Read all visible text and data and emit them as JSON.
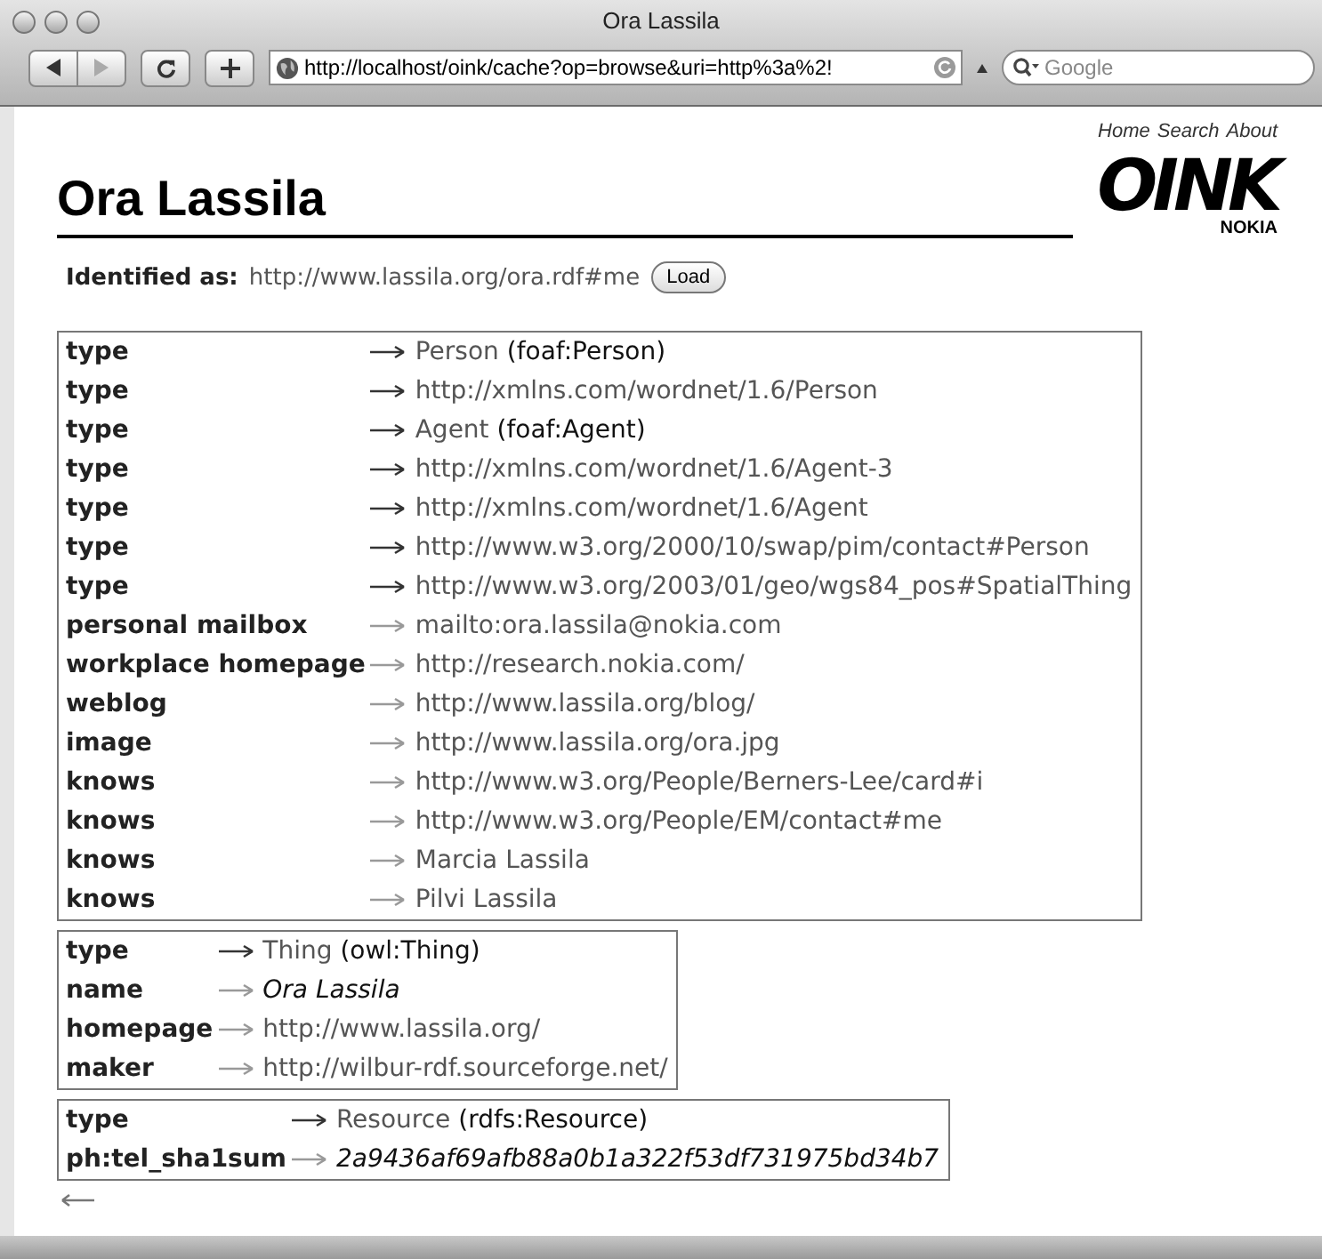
{
  "window": {
    "title": "Ora Lassila"
  },
  "toolbar": {
    "url": "http://localhost/oink/cache?op=browse&uri=http%3a%2!",
    "search_placeholder": "Google"
  },
  "nav": [
    "Home",
    "Search",
    "About"
  ],
  "logo": {
    "text": "OINK",
    "subtext": "NOKIA"
  },
  "page_title": "Ora Lassila",
  "identified": {
    "label": "Identified as:",
    "uri": "http://www.lassila.org/ora.rdf#me",
    "button": "Load"
  },
  "resources": [
    {
      "rows": [
        {
          "property": "type",
          "dark_arrow": true,
          "kind": "class",
          "value": "Person",
          "qname": "(foaf:Person)"
        },
        {
          "property": "type",
          "dark_arrow": true,
          "kind": "uri",
          "value": "http://xmlns.com/wordnet/1.6/Person"
        },
        {
          "property": "type",
          "dark_arrow": true,
          "kind": "class",
          "value": "Agent",
          "qname": "(foaf:Agent)"
        },
        {
          "property": "type",
          "dark_arrow": true,
          "kind": "uri",
          "value": "http://xmlns.com/wordnet/1.6/Agent-3"
        },
        {
          "property": "type",
          "dark_arrow": true,
          "kind": "uri",
          "value": "http://xmlns.com/wordnet/1.6/Agent"
        },
        {
          "property": "type",
          "dark_arrow": true,
          "kind": "uri",
          "value": "http://www.w3.org/2000/10/swap/pim/contact#Person"
        },
        {
          "property": "type",
          "dark_arrow": true,
          "kind": "uri",
          "value": "http://www.w3.org/2003/01/geo/wgs84_pos#SpatialThing"
        },
        {
          "property": "personal mailbox",
          "dark_arrow": false,
          "kind": "uri",
          "value": "mailto:ora.lassila@nokia.com"
        },
        {
          "property": "workplace homepage",
          "dark_arrow": false,
          "kind": "uri",
          "value": "http://research.nokia.com/"
        },
        {
          "property": "weblog",
          "dark_arrow": false,
          "kind": "uri",
          "value": "http://www.lassila.org/blog/"
        },
        {
          "property": "image",
          "dark_arrow": false,
          "kind": "uri",
          "value": "http://www.lassila.org/ora.jpg"
        },
        {
          "property": "knows",
          "dark_arrow": false,
          "kind": "uri",
          "value": "http://www.w3.org/People/Berners-Lee/card#i"
        },
        {
          "property": "knows",
          "dark_arrow": false,
          "kind": "uri",
          "value": "http://www.w3.org/People/EM/contact#me"
        },
        {
          "property": "knows",
          "dark_arrow": false,
          "kind": "uri",
          "value": "Marcia Lassila"
        },
        {
          "property": "knows",
          "dark_arrow": false,
          "kind": "uri",
          "value": "Pilvi Lassila"
        }
      ]
    },
    {
      "rows": [
        {
          "property": "type",
          "dark_arrow": true,
          "kind": "class",
          "value": "Thing",
          "qname": "(owl:Thing)"
        },
        {
          "property": "name",
          "dark_arrow": false,
          "kind": "literal",
          "value": "Ora Lassila"
        },
        {
          "property": "homepage",
          "dark_arrow": false,
          "kind": "uri",
          "value": "http://www.lassila.org/"
        },
        {
          "property": "maker",
          "dark_arrow": false,
          "kind": "uri",
          "value": "http://wilbur-rdf.sourceforge.net/"
        }
      ]
    },
    {
      "rows": [
        {
          "property": "type",
          "dark_arrow": true,
          "kind": "class",
          "value": "Resource",
          "qname": "(rdfs:Resource)"
        },
        {
          "property": "ph:tel_sha1sum",
          "dark_arrow": false,
          "kind": "literal",
          "value": "2a9436af69afb88a0b1a322f53df731975bd34b7"
        }
      ]
    }
  ]
}
